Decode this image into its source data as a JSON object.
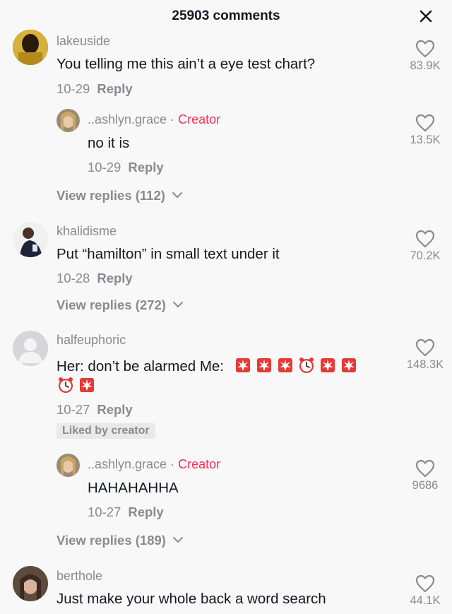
{
  "header": {
    "title": "25903 comments"
  },
  "comments": [
    {
      "username": "lakeuside",
      "text": "You telling me this ain’t a eye test chart?",
      "date": "10-29",
      "reply_label": "Reply",
      "likes": "83.9K",
      "reply": {
        "username": "..ashlyn.grace",
        "creator_label": "Creator",
        "separator": "·",
        "text": "no it is",
        "date": "10-29",
        "reply_label": "Reply",
        "likes": "13.5K"
      },
      "view_replies": "View replies (112)"
    },
    {
      "username": "khalidisme",
      "text": "Put “hamilton” in small text under it",
      "date": "10-28",
      "reply_label": "Reply",
      "likes": "70.2K",
      "view_replies": "View replies (272)"
    },
    {
      "username": "halfeuphoric",
      "text": "Her: don’t be alarmed Me:",
      "emojis_line1": [
        "police-light",
        "police-light",
        "police-light",
        "alarm-clock",
        "police-light",
        "police-light"
      ],
      "emojis_line2": [
        "alarm-clock",
        "police-light"
      ],
      "date": "10-27",
      "reply_label": "Reply",
      "likes": "148.3K",
      "liked_badge": "Liked by creator",
      "reply": {
        "username": "..ashlyn.grace",
        "creator_label": "Creator",
        "separator": "·",
        "text": "HAHAHAHHA",
        "date": "10-27",
        "reply_label": "Reply",
        "likes": "9686"
      },
      "view_replies": "View replies (189)"
    },
    {
      "username": "berthole",
      "text": "Just make your whole back a word search",
      "likes": "44.1K"
    }
  ],
  "colors": {
    "accent": "#fe2c55",
    "muted": "#8a8b91",
    "text": "#161823",
    "background": "#f8f8f8"
  }
}
